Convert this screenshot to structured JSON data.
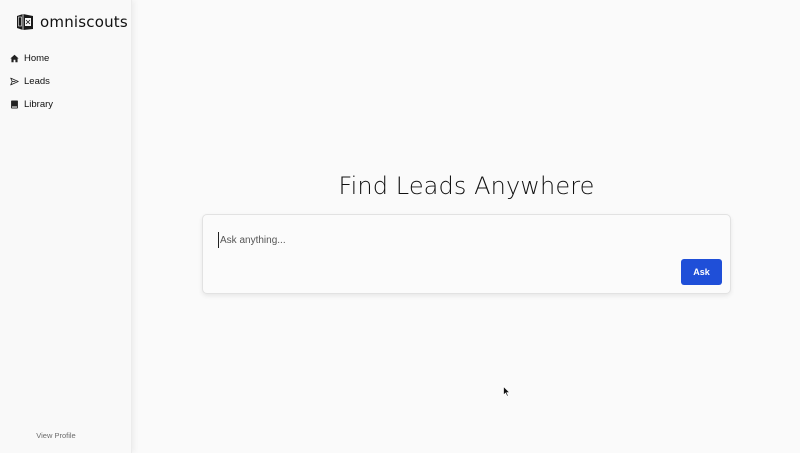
{
  "brand": {
    "name": "omniscouts",
    "logo_icon": "box-logo-icon"
  },
  "sidebar": {
    "items": [
      {
        "label": "Home",
        "icon": "home-icon"
      },
      {
        "label": "Leads",
        "icon": "send-icon"
      },
      {
        "label": "Library",
        "icon": "book-icon"
      }
    ],
    "view_profile": "View Profile"
  },
  "main": {
    "heading": "Find Leads Anywhere",
    "search": {
      "placeholder": "Ask anything...",
      "value": ""
    },
    "ask_label": "Ask"
  },
  "colors": {
    "accent": "#1f4fd8",
    "background": "#fafafa",
    "sidebar_bg": "#f9f9f9"
  }
}
